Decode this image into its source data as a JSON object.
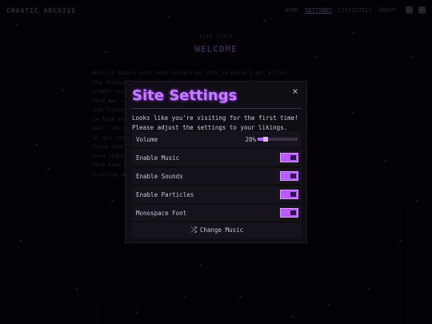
{
  "background": {
    "brand": "CHAOTIC ARCHIVE",
    "nav": [
      "HOME",
      "SETTINGS",
      "STATISTICS",
      "ABOUT"
    ],
    "active_nav": 1,
    "subtitle": "Site Title",
    "title": "WELCOME",
    "text_lines": [
      "Back to basics with some tinkering: this is where I put all of",
      "the things I make and am currently focused on. Built with a very",
      "simple stack and mostly out of curiosity, a rough draft of things",
      "that may or may not stay around for long, some of which",
      "are finished and others in constant progress. Feel free",
      "to look around, find what you like, and leave whenever you",
      "want. The music player is on the top-right and can be changed",
      "at any time along with the particles and the fonts below.",
      "Enjoy your stay and don't forget to check back later for",
      "more updates, projects, experiments and other small things",
      "that keep me busy on weekends and slow nights, thanks for",
      "visiting and have a nice day."
    ]
  },
  "modal": {
    "title": "Site Settings",
    "close": "×",
    "intro": "Looks like you're visiting for the first time! Please adjust the settings to your likings.",
    "volume": {
      "label": "Volume",
      "value_text": "20%",
      "level": 0.2
    },
    "toggles": [
      {
        "label": "Enable Music",
        "on": true
      },
      {
        "label": "Enable Sounds",
        "on": true
      },
      {
        "label": "Enable Particles",
        "on": true
      },
      {
        "label": "Monospace Font",
        "on": true
      }
    ],
    "change_music": {
      "label": "Change Music",
      "icon": "shuffle-icon"
    }
  },
  "colors": {
    "accent": "#c77dff",
    "toggle": "#b85cff",
    "background": "#050309",
    "panel": "#100d15"
  }
}
